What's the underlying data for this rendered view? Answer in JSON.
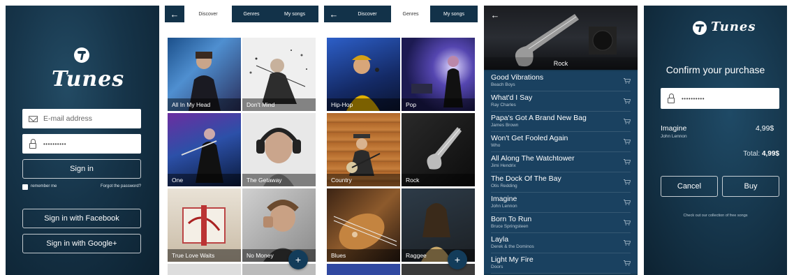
{
  "login": {
    "brand": "Tunes",
    "email_placeholder": "E-mail address",
    "password_value": "••••••••••",
    "sign_in": "Sign in",
    "remember_me": "remember me",
    "forgot": "Forgot the password?",
    "facebook": "Sign in with Facebook",
    "google": "Sign in with Google+"
  },
  "tabs": {
    "discover": "Discover",
    "genres": "Genres",
    "my_songs": "My songs"
  },
  "discover_tiles": [
    "All In My Head",
    "Don't Mind",
    "One",
    "The Getaway",
    "True Love Waits",
    "No Money"
  ],
  "genre_tiles": [
    "Hip-Hop",
    "Pop",
    "Country",
    "Rock",
    "Blues",
    "Raggee"
  ],
  "fab_label": "+",
  "genre_detail": {
    "title": "Rock",
    "songs": [
      {
        "title": "Good Vibrations",
        "artist": "Beach Boys"
      },
      {
        "title": "What'd I Say",
        "artist": "Ray Charles"
      },
      {
        "title": "Papa's Got A Brand New Bag",
        "artist": "James Brown"
      },
      {
        "title": "Won't Get Fooled Again",
        "artist": "Who"
      },
      {
        "title": "All Along The Watchtower",
        "artist": "Jimi Hendrix"
      },
      {
        "title": "The Dock Of The Bay",
        "artist": "Otis Redding"
      },
      {
        "title": "Imagine",
        "artist": "John Lennon"
      },
      {
        "title": "Born To Run",
        "artist": "Bruce Springsteen"
      },
      {
        "title": "Layla",
        "artist": "Derek & the Dominos"
      },
      {
        "title": "Light My Fire",
        "artist": "Doors"
      }
    ]
  },
  "purchase": {
    "brand": "Tunes",
    "title": "Confirm your purchase",
    "password_value": "••••••••••",
    "item_title": "Imagine",
    "item_artist": "John Lennon",
    "item_price": "4,99$",
    "total_label": "Total:",
    "total_value": "4,99$",
    "cancel": "Cancel",
    "buy": "Buy",
    "footer": "Check out our collection of free songs"
  },
  "colors": {
    "navy": "#123249",
    "panel": "#1a4160",
    "white": "#ffffff"
  }
}
